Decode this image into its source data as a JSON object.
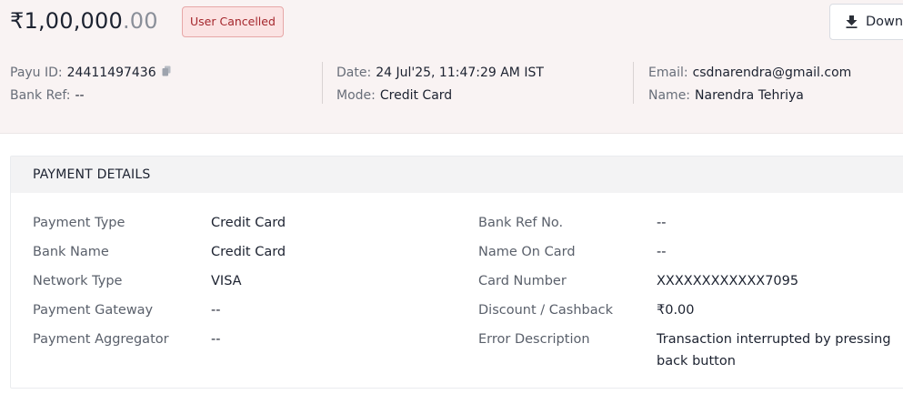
{
  "header": {
    "amount_main": "₹1,00,000",
    "amount_decimal": ".00",
    "status_badge": "User Cancelled",
    "download_label": "Down",
    "download_icon": "download-icon",
    "meta": {
      "payu_id_label": "Payu ID:",
      "payu_id_value": "24411497436",
      "copy_icon": "copy-icon",
      "bank_ref_label": "Bank Ref:",
      "bank_ref_value": "--",
      "date_label": "Date:",
      "date_value": "24 Jul'25, 11:47:29 AM IST",
      "mode_label": "Mode:",
      "mode_value": "Credit Card",
      "email_label": "Email:",
      "email_value": "csdnarendra@gmail.com",
      "name_label": "Name:",
      "name_value": "Narendra Tehriya"
    }
  },
  "payment_details": {
    "title": "PAYMENT DETAILS",
    "left": [
      {
        "label": "Payment Type",
        "value": "Credit Card"
      },
      {
        "label": "Bank Name",
        "value": "Credit Card"
      },
      {
        "label": "Network Type",
        "value": "VISA"
      },
      {
        "label": "Payment Gateway",
        "value": "--"
      },
      {
        "label": "Payment Aggregator",
        "value": "--"
      }
    ],
    "right": [
      {
        "label": "Bank Ref No.",
        "value": "--"
      },
      {
        "label": "Name On Card",
        "value": "--"
      },
      {
        "label": "Card Number",
        "value": "XXXXXXXXXXXX7095"
      },
      {
        "label": "Discount / Cashback",
        "value": "₹0.00"
      },
      {
        "label": "Error Description",
        "value": "Transaction interrupted by pressing back button"
      }
    ]
  },
  "colors": {
    "header_bg": "#f9f3f3",
    "status_text": "#a4262c",
    "status_bg": "#fbe3e3"
  }
}
